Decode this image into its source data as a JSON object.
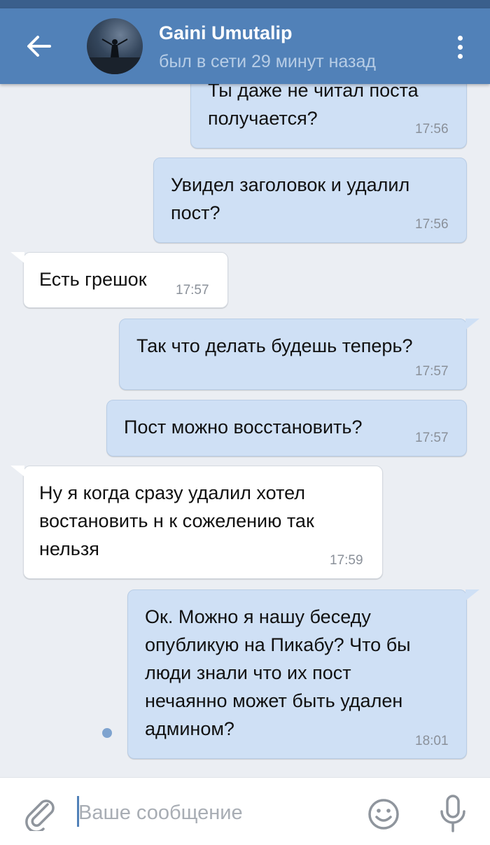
{
  "header": {
    "name": "Gaini Umutalip",
    "status": "был в сети 29 минут назад",
    "back_icon": "arrow-left-icon",
    "menu_icon": "more-vertical-icon"
  },
  "messages": [
    {
      "direction": "out",
      "lines": [
        "Ты даже не читал поста",
        "получается?"
      ],
      "time": "17:56"
    },
    {
      "direction": "out",
      "lines": [
        "Увидел заголовок и удалил",
        "пост?"
      ],
      "time": "17:56"
    },
    {
      "direction": "in",
      "lines": [
        "Есть грешок"
      ],
      "time": "17:57"
    },
    {
      "direction": "out",
      "lines": [
        "Так что делать будешь теперь?"
      ],
      "time": "17:57"
    },
    {
      "direction": "out",
      "lines": [
        "Пост можно восстановить?"
      ],
      "time": "17:57"
    },
    {
      "direction": "in",
      "lines": [
        "Ну я когда сразу удалил хотел",
        "востановить н к сожелению так",
        "нельзя"
      ],
      "time": "17:59"
    },
    {
      "direction": "out",
      "lines": [
        "Ок. Можно я нашу беседу",
        "опубликую на Пикабу? Что бы",
        "люди знали что их пост",
        "нечаянно может быть удален",
        "админом?"
      ],
      "time": "18:01"
    }
  ],
  "composer": {
    "placeholder": "Ваше сообщение",
    "icons": [
      "paperclip-icon",
      "smile-icon",
      "microphone-icon"
    ]
  },
  "colors": {
    "header": "#5181b8",
    "outgoing_bubble": "#cfe0f5",
    "incoming_bubble": "#ffffff",
    "background": "#ebeef3"
  }
}
